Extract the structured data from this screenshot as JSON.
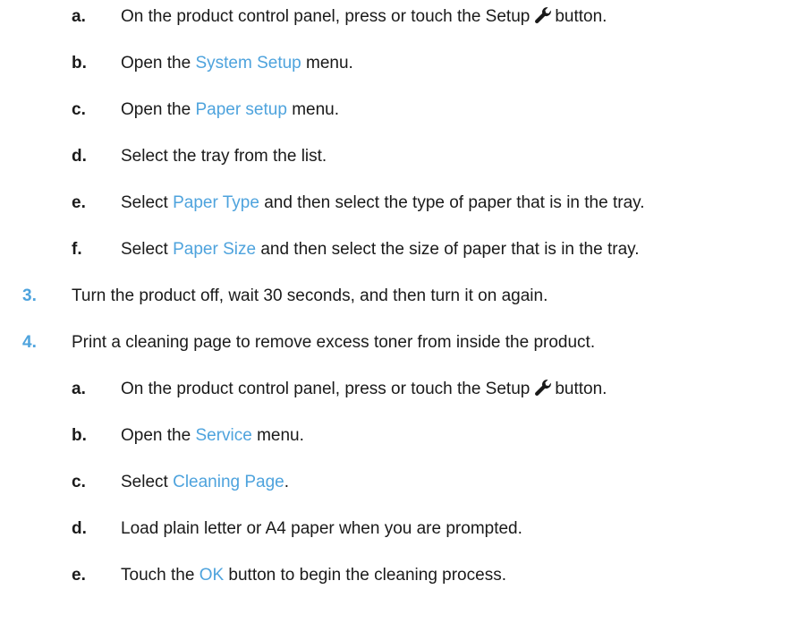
{
  "steps": [
    {
      "marker": "a.",
      "pre": "On the product control panel, press or touch the Setup",
      "icon": "wrench-icon",
      "post": "button."
    },
    {
      "marker": "b.",
      "pre": "Open the",
      "hl": "System Setup",
      "post": "menu."
    },
    {
      "marker": "c.",
      "pre": "Open the",
      "hl": "Paper setup",
      "post": "menu."
    },
    {
      "marker": "d.",
      "pre": "Select the tray from the list."
    },
    {
      "marker": "e.",
      "pre": "Select",
      "hl": "Paper Type",
      "post": "and then select the type of paper that is in the tray."
    },
    {
      "marker": "f.",
      "pre": "Select",
      "hl": "Paper Size",
      "post": "and then select the size of paper that is in the tray."
    },
    {
      "marker": "3.",
      "pre": "Turn the product off, wait 30 seconds, and then turn it on again."
    },
    {
      "marker": "4.",
      "pre": "Print a cleaning page to remove excess toner from inside the product."
    },
    {
      "marker": "a.",
      "pre": "On the product control panel, press or touch the Setup",
      "icon": "wrench-icon",
      "post": "button."
    },
    {
      "marker": "b.",
      "pre": "Open the",
      "hl": "Service",
      "post": "menu."
    },
    {
      "marker": "c.",
      "pre": "Select",
      "hl": "Cleaning Page",
      "post": "."
    },
    {
      "marker": "d.",
      "pre": "Load plain letter or A4 paper when you are prompted."
    },
    {
      "marker": "e.",
      "pre": "Touch the",
      "hl": "OK",
      "post": "button to begin the cleaning process."
    }
  ],
  "colors": {
    "highlight": "#4ea3dd",
    "text": "#1a1a1a"
  }
}
